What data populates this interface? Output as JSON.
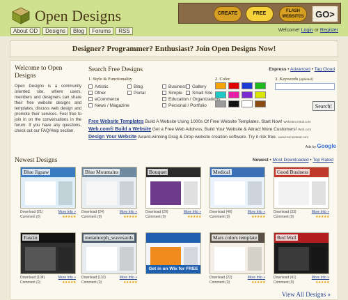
{
  "header": {
    "logo_text": "Open Designs",
    "banner": {
      "pill1": "CREATE",
      "pill2": "FREE",
      "pill3": "FLASH WEBSITES",
      "go": "GO>"
    },
    "nav": [
      "About OD",
      "Designs",
      "Blog",
      "Forums",
      "RSS"
    ],
    "auth_prefix": "Welcome!",
    "login": "Login",
    "or": "or",
    "register": "Register"
  },
  "tagline": "Designer? Programmer? Enthusiast? Join Open Designs Now!",
  "welcome": {
    "title": "Welcome to Open Designs",
    "text": "Open Designs is a community oriented site, where users, members and designers can share their free website designs and templates, discuss web design and promote their services. Feel free to join in on the conversations in the forum. If you have any questions, check out our FAQ/Help section."
  },
  "search": {
    "title": "Search Free Designs",
    "express": "Express",
    "advanced": "Advanced",
    "tag_cloud": "Tag Cloud",
    "step1": "1. Style & Functionality",
    "styles_col1": [
      "Artistic",
      "Other",
      "eCommerce",
      "News / Magazine"
    ],
    "styles_col2": [
      "Blog",
      "Portal"
    ],
    "styles_col3": [
      "Business",
      "Simple",
      "Education / Organizations",
      "Personal / Portfolio"
    ],
    "styles_col4": [
      "Gallery",
      "Small Site"
    ],
    "step2": "2. Color",
    "colors": [
      "#f4a300",
      "#e00000",
      "#1f3bd6",
      "#1fb81f",
      "#1fc7c7",
      "#e81ca8",
      "#7c2bd1",
      "#d9e600",
      "#9a9a9a",
      "#111111",
      "#ffffff",
      "#8a4a10"
    ],
    "step3": "3. Keywords",
    "step3_hint": "(optional)",
    "button": "Search!"
  },
  "ads": [
    {
      "link": "Free Website Templates",
      "text": "Build A Website Using 1000s Of Free Website Templates. Start Now!",
      "src": "Websites.Intuit.com"
    },
    {
      "link": "Web.com® Build a Website",
      "text": "Get a Free Web Address, Build Your Website & Attract More Customers!",
      "src": "Web.com"
    },
    {
      "link": "Design Your Website",
      "text": "Award-winning Drag & Drop website creation software. Try it risk free.",
      "src": "www.Homestead.com"
    }
  ],
  "ads_by": "Ads by",
  "ads_google": "Google",
  "newest": {
    "title": "Newest Designs",
    "tab_newest": "Newest",
    "tab_downloaded": "Most Downloaded",
    "tab_rated": "Top Rated",
    "view_all": "View All Designs »",
    "cards": [
      {
        "name": "Blue Jigsaw",
        "download": "Download (21)",
        "comment": "Comment (0)",
        "more": "More Info »",
        "stars": "★★★★★"
      },
      {
        "name": "Blue Mountains",
        "download": "Download (24)",
        "comment": "Comment (0)",
        "more": "More Info »",
        "stars": "★★★★★"
      },
      {
        "name": "Bouquet",
        "download": "Download (29)",
        "comment": "Comment (0)",
        "more": "More Info »",
        "stars": "★★★★★"
      },
      {
        "name": "Medical",
        "download": "Download (40)",
        "comment": "Comment (0)",
        "more": "More Info »",
        "stars": "★★★★★"
      },
      {
        "name": "Good Business",
        "download": "Download (33)",
        "comment": "Comment (0)",
        "more": "More Info »",
        "stars": "★★★★★"
      },
      {
        "name": "Fascin",
        "download": "Download (104)",
        "comment": "Comment (0)",
        "more": "More Info »",
        "stars": "★★★★★"
      },
      {
        "name": "metamorph_wavesards",
        "download": "Download (110)",
        "comment": "Comment (0)",
        "more": "More Info »",
        "stars": "★★★★★"
      },
      {
        "name": "",
        "overlay": "Get in on Wix for FREE",
        "download": "",
        "comment": "",
        "more": "",
        "stars": ""
      },
      {
        "name": "Mars colors template",
        "download": "Download (22)",
        "comment": "Comment (0)",
        "more": "More Info »",
        "stars": "★★★★★"
      },
      {
        "name": "Red Wall",
        "download": "Download (41)",
        "comment": "Comment (0)",
        "more": "More Info »",
        "stars": "★★★★★"
      }
    ]
  }
}
